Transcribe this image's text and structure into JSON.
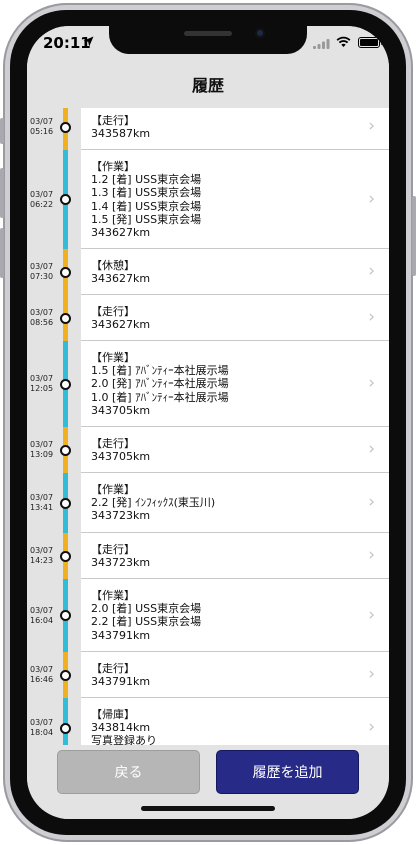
{
  "status_bar": {
    "time": "20:11",
    "icons": [
      "location-arrow-icon",
      "signal-icon",
      "wifi-icon",
      "battery-icon"
    ]
  },
  "nav": {
    "title": "履歴"
  },
  "colors": {
    "rail_yellow": "#f0b020",
    "rail_blue": "#32bcd8",
    "add_button": "#272a86",
    "back_button": "#b6b6b6"
  },
  "entries": [
    {
      "date": "03/07",
      "time": "05:16",
      "lines": [
        "【走行】",
        "343587km"
      ],
      "rail": "yellow"
    },
    {
      "date": "03/07",
      "time": "06:22",
      "lines": [
        "【作業】",
        "1.2 [着] USS東京会場",
        "1.3 [着] USS東京会場",
        "1.4 [着] USS東京会場",
        "1.5 [発] USS東京会場",
        "343627km"
      ],
      "rail": "blue"
    },
    {
      "date": "03/07",
      "time": "07:30",
      "lines": [
        "【休憩】",
        "343627km"
      ],
      "rail": "yellow"
    },
    {
      "date": "03/07",
      "time": "08:56",
      "lines": [
        "【走行】",
        "343627km"
      ],
      "rail": "yellow"
    },
    {
      "date": "03/07",
      "time": "12:05",
      "lines": [
        "【作業】",
        "1.5 [着] ｱﾊﾞﾝﾃｨｰ本社展示場",
        "2.0 [発] ｱﾊﾞﾝﾃｨｰ本社展示場",
        "1.0 [着] ｱﾊﾞﾝﾃｨｰ本社展示場",
        "343705km"
      ],
      "rail": "blue"
    },
    {
      "date": "03/07",
      "time": "13:09",
      "lines": [
        "【走行】",
        "343705km"
      ],
      "rail": "yellow"
    },
    {
      "date": "03/07",
      "time": "13:41",
      "lines": [
        "【作業】",
        "2.2 [発] ｲﾝﾌｨｯｸｽ(東玉川)",
        "343723km"
      ],
      "rail": "blue"
    },
    {
      "date": "03/07",
      "time": "14:23",
      "lines": [
        "【走行】",
        "343723km"
      ],
      "rail": "yellow"
    },
    {
      "date": "03/07",
      "time": "16:04",
      "lines": [
        "【作業】",
        "2.0 [着] USS東京会場",
        "2.2 [着] USS東京会場",
        "343791km"
      ],
      "rail": "blue"
    },
    {
      "date": "03/07",
      "time": "16:46",
      "lines": [
        "【走行】",
        "343791km"
      ],
      "rail": "yellow"
    },
    {
      "date": "03/07",
      "time": "18:04",
      "lines": [
        "【帰庫】",
        "343814km",
        "写真登録あり"
      ],
      "rail": "blue"
    }
  ],
  "buttons": {
    "back": "戻る",
    "add": "履歴を追加"
  }
}
